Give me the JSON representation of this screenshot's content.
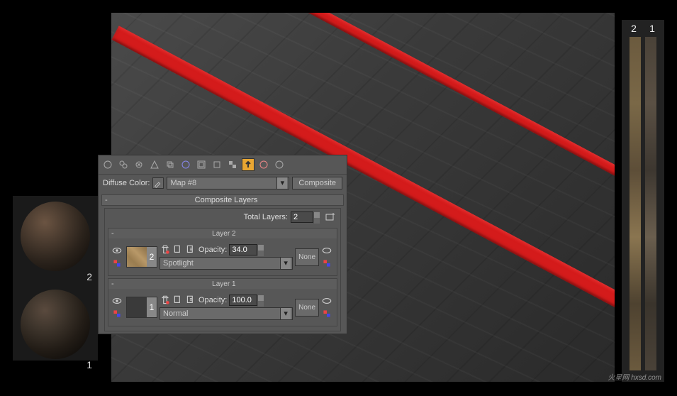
{
  "sphere_labels": {
    "top": "2",
    "bottom": "1"
  },
  "strip_labels": {
    "left": "2",
    "right": "1"
  },
  "panel": {
    "diffuse_label": "Diffuse Color:",
    "map_name": "Map #8",
    "map_type": "Composite",
    "section_composite": "Composite Layers",
    "total_layers_label": "Total Layers:",
    "total_layers": "2",
    "layer2": {
      "title": "Layer 2",
      "num": "2",
      "opacity_label": "Opacity:",
      "opacity": "34.0",
      "blend": "Spotlight",
      "none": "None"
    },
    "layer1": {
      "title": "Layer 1",
      "num": "1",
      "opacity_label": "Opacity:",
      "opacity": "100.0",
      "blend": "Normal",
      "none": "None"
    }
  },
  "watermark": "火星网 hxsd.com"
}
